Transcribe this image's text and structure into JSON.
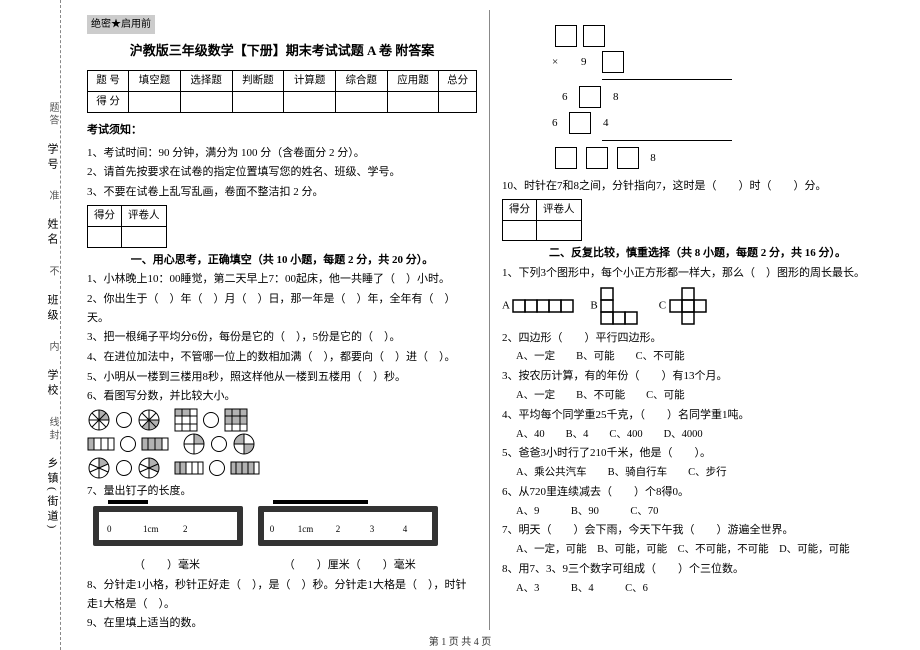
{
  "binding": {
    "labels": [
      "学号",
      "姓名",
      "班级",
      "学校",
      "乡镇(街道)"
    ],
    "marks": [
      "题",
      "答",
      "准",
      "不",
      "内",
      "线",
      "封"
    ]
  },
  "secret": "绝密★启用前",
  "title": "沪教版三年级数学【下册】期末考试试题 A 卷 附答案",
  "score_table": {
    "row1": [
      "题 号",
      "填空题",
      "选择题",
      "判断题",
      "计算题",
      "综合题",
      "应用题",
      "总分"
    ],
    "row2_label": "得 分"
  },
  "notice_head": "考试须知：",
  "notice": [
    "1、考试时间：90 分钟，满分为 100 分（含卷面分 2 分）。",
    "2、请首先按要求在试卷的指定位置填写您的姓名、班级、学号。",
    "3、不要在试卷上乱写乱画，卷面不整洁扣 2 分。"
  ],
  "mini": {
    "c1": "得分",
    "c2": "评卷人"
  },
  "sec1": "一、用心思考，正确填空（共 10 小题，每题 2 分，共 20 分）。",
  "q1": "1、小林晚上10：00睡觉，第二天早上7：00起床，他一共睡了（　）小时。",
  "q2": "2、你出生于（　）年（　）月（　）日，那一年是（　）年，全年有（　）天。",
  "q3": "3、把一根绳子平均分6份，每份是它的（　），5份是它的（　）。",
  "q4": "4、在进位加法中，不管哪一位上的数相加满（　），都要向（　）进（　）。",
  "q5": "5、小明从一楼到三楼用8秒，照这样他从一楼到五楼用（　）秒。",
  "q6": "6、看图写分数，并比较大小。",
  "q7": "7、量出钉子的长度。",
  "ruler_unit_cm": "1cm",
  "ruler_nums": [
    "0",
    "1",
    "2"
  ],
  "ruler_nums2": [
    "0",
    "1",
    "2",
    "3",
    "4"
  ],
  "q7a": "（　　）毫米",
  "q7b": "（　　）厘米（　　）毫米",
  "q8": "8、分针走1小格，秒针正好走（　），是（　）秒。分针走1大格是（　），时针走1大格是（　）。",
  "q9": "9、在里填上适当的数。",
  "mult_sign": "×",
  "mult_9": "9",
  "m_6": "6",
  "m_8": "8",
  "m_4": "4",
  "q10": "10、时针在7和8之间，分针指向7，这时是（　　）时（　　）分。",
  "sec2": "二、反复比较，慎重选择（共 8 小题，每题 2 分，共 16 分）。",
  "s2q1": "1、下列3个图形中，每个小正方形都一样大，那么（　）图形的周长最长。",
  "labA": "A",
  "labB": "B",
  "labC": "C",
  "s2q2": "2、四边形（　　）平行四边形。",
  "s2q2o": "A、一定　　B、可能　　C、不可能",
  "s2q3": "3、按农历计算，有的年份（　　）有13个月。",
  "s2q3o": "A、一定　　B、不可能　　C、可能",
  "s2q4": "4、平均每个同学重25千克，（　　）名同学重1吨。",
  "s2q4o": "A、40　　B、4　　C、400　　D、4000",
  "s2q5": "5、爸爸3小时行了210千米，他是（　　）。",
  "s2q5o": "A、乘公共汽车　　B、骑自行车　　C、步行",
  "s2q6": "6、从720里连续减去（　　）个8得0。",
  "s2q6o": "A、9　　　B、90　　　C、70",
  "s2q7": "7、明天（　　）会下雨，今天下午我（　　）游遍全世界。",
  "s2q7o": "A、一定，可能　B、可能，可能　C、不可能，不可能　D、可能，可能",
  "s2q8": "8、用7、3、9三个数字可组成（　　）个三位数。",
  "s2q8o": "A、3　　　B、4　　　C、6",
  "footer": "第 1 页 共 4 页"
}
